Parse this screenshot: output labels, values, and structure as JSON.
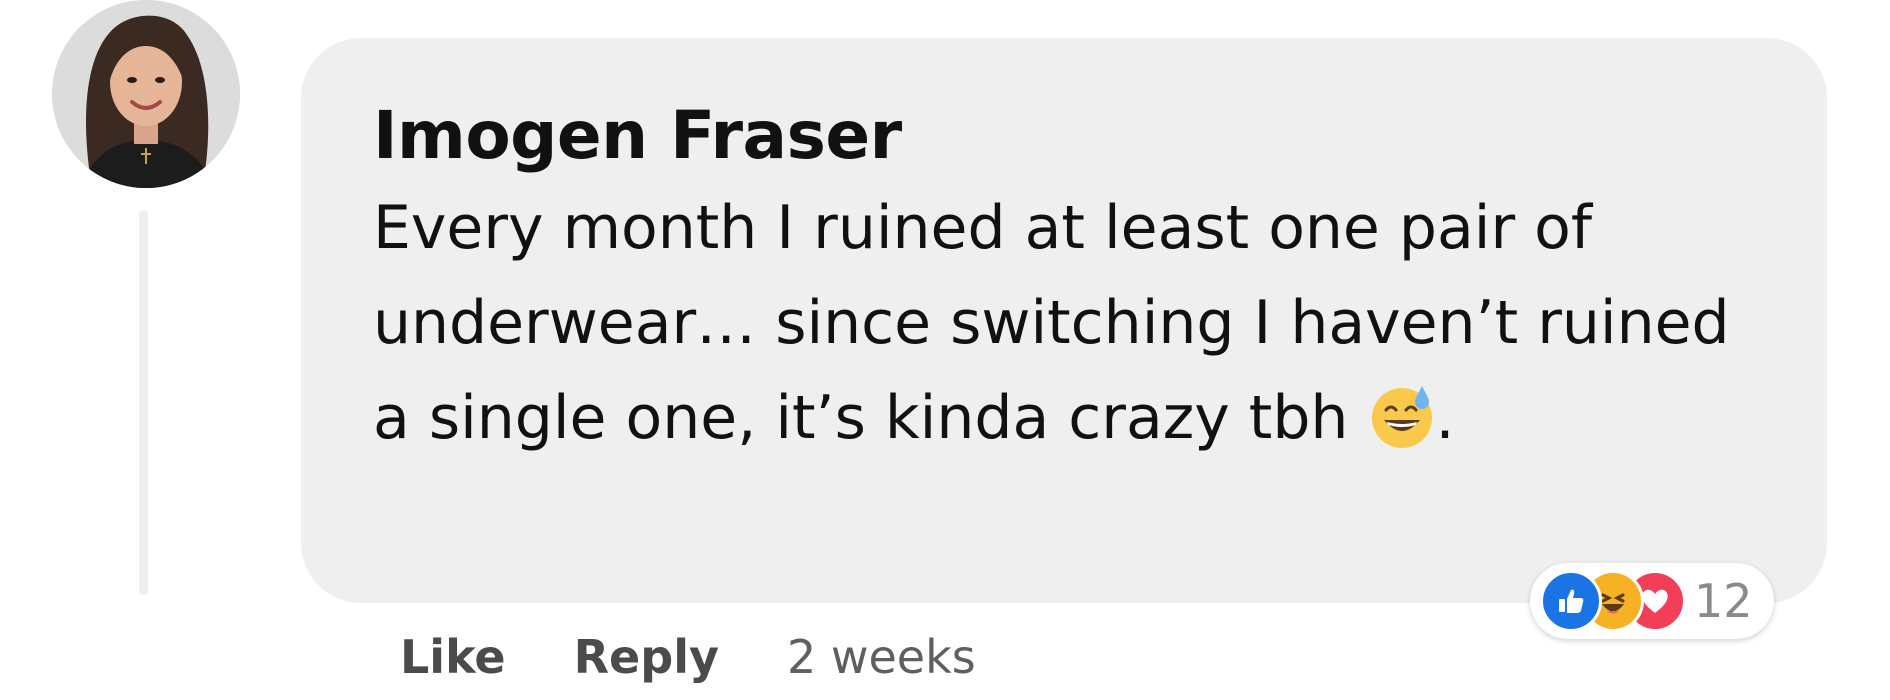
{
  "comment": {
    "author": "Imogen Fraser",
    "text": "Every month I ruined at least one pair of underwear… since switching I haven’t ruined a single one, it’s kinda crazy tbh",
    "text_end": ".",
    "emoji": "grinning-face-with-sweat-emoji",
    "avatar": "profile-photo"
  },
  "reactions": {
    "icons": [
      "like-icon",
      "haha-icon",
      "love-icon"
    ],
    "count": "12"
  },
  "actions": {
    "like_label": "Like",
    "reply_label": "Reply",
    "timestamp": "2 weeks"
  },
  "colors": {
    "bubble_bg": "#efefef",
    "text": "#111111",
    "like_blue": "#1b74e4",
    "haha_yellow": "#f7b125",
    "love_red": "#f33e58",
    "action_gray": "#4b4b4b"
  }
}
